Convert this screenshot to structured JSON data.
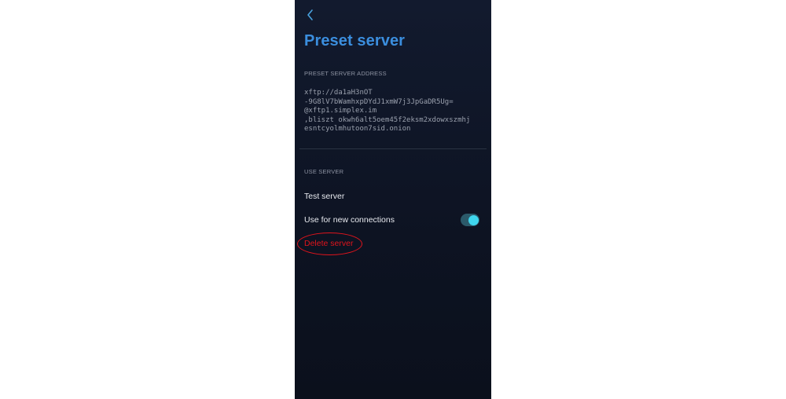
{
  "header": {
    "title": "Preset server",
    "back_icon": "chevron-left-icon"
  },
  "preset_address_section": {
    "header": "PRESET SERVER ADDRESS",
    "address_lines": [
      "xftp://da1aH3nOT",
      "-9G8lV7bWamhxpDYdJ1xmW7j3JpGaDR5Ug=",
      "@xftp1.simplex.im",
      ",bliszt okwh6alt5oem45f2eksm2xdowxszmhj",
      "esntcyolmhutoon7sid.onion"
    ]
  },
  "use_server_section": {
    "header": "USE SERVER",
    "test_server_label": "Test server",
    "use_for_new_connections_label": "Use for new connections",
    "use_for_new_connections_enabled": true,
    "delete_server_label": "Delete server"
  },
  "colors": {
    "title": "#3b8ede",
    "accent_toggle": "#3fd6ee",
    "danger": "#e0141c",
    "background": "#0d1322"
  }
}
